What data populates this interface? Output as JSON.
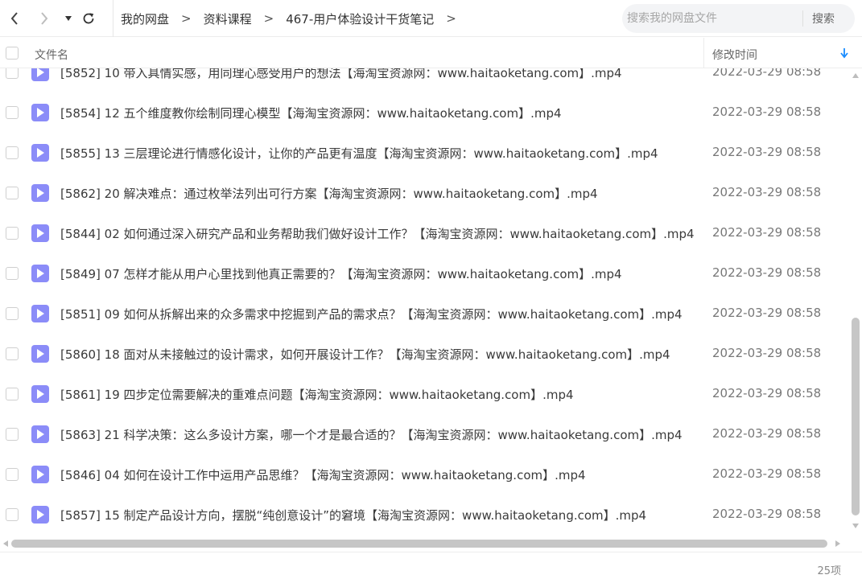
{
  "nav": {
    "breadcrumbs": [
      "我的网盘",
      "资料课程",
      "467-用户体验设计干货笔记"
    ],
    "separator": ">"
  },
  "search": {
    "placeholder": "搜索我的网盘文件",
    "button_label": "搜索"
  },
  "table": {
    "headers": {
      "name": "文件名",
      "modified": "修改时间"
    },
    "sort": "modified-desc",
    "rows": [
      {
        "name": "[5852] 10  带入具情实感，用同理心感受用户的想法【海淘宝资源网：www.haitaoketang.com】.mp4",
        "time": "2022-03-29 08:58"
      },
      {
        "name": "[5854] 12  五个维度教你绘制同理心模型【海淘宝资源网：www.haitaoketang.com】.mp4",
        "time": "2022-03-29 08:58"
      },
      {
        "name": "[5855] 13  三层理论进行情感化设计，让你的产品更有温度【海淘宝资源网：www.haitaoketang.com】.mp4",
        "time": "2022-03-29 08:58"
      },
      {
        "name": "[5862] 20  解决难点：通过枚举法列出可行方案【海淘宝资源网：www.haitaoketang.com】.mp4",
        "time": "2022-03-29 08:58"
      },
      {
        "name": "[5844] 02  如何通过深入研究产品和业务帮助我们做好设计工作？【海淘宝资源网：www.haitaoketang.com】.mp4",
        "time": "2022-03-29 08:58"
      },
      {
        "name": "[5849] 07  怎样才能从用户心里找到他真正需要的？【海淘宝资源网：www.haitaoketang.com】.mp4",
        "time": "2022-03-29 08:58"
      },
      {
        "name": "[5851] 09  如何从拆解出来的众多需求中挖掘到产品的需求点？【海淘宝资源网：www.haitaoketang.com】.mp4",
        "time": "2022-03-29 08:58"
      },
      {
        "name": "[5860] 18  面对从未接触过的设计需求，如何开展设计工作？【海淘宝资源网：www.haitaoketang.com】.mp4",
        "time": "2022-03-29 08:58"
      },
      {
        "name": "[5861] 19  四步定位需要解决的重难点问题【海淘宝资源网：www.haitaoketang.com】.mp4",
        "time": "2022-03-29 08:58"
      },
      {
        "name": "[5863] 21  科学决策：这么多设计方案，哪一个才是最合适的？【海淘宝资源网：www.haitaoketang.com】.mp4",
        "time": "2022-03-29 08:58"
      },
      {
        "name": "[5846] 04  如何在设计工作中运用产品思维？【海淘宝资源网：www.haitaoketang.com】.mp4",
        "time": "2022-03-29 08:58"
      },
      {
        "name": "[5857] 15  制定产品设计方向，摆脱“纯创意设计”的窘境【海淘宝资源网：www.haitaoketang.com】.mp4",
        "time": "2022-03-29 08:58"
      }
    ]
  },
  "footer": {
    "count": "25项"
  },
  "colors": {
    "accent": "#1a8cff",
    "file_icon": "#8b8cf8"
  },
  "icons": {
    "back": "chevron-left-icon",
    "forward": "chevron-right-icon",
    "history": "caret-down-icon",
    "refresh": "refresh-icon",
    "sort": "sort-down-arrow-icon",
    "file": "video-file-icon"
  }
}
